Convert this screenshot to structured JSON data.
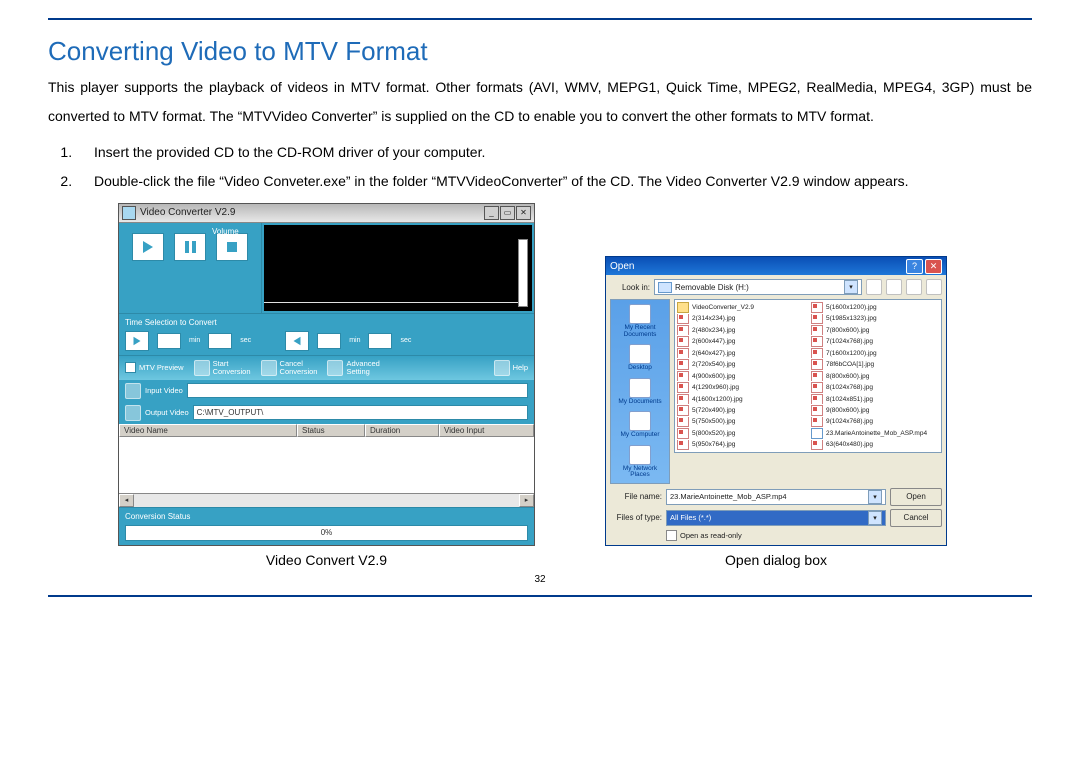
{
  "heading": "Converting Video to MTV Format",
  "intro": "This player supports the playback of videos in MTV format. Other formats (AVI, WMV, MEPG1, Quick Time, MPEG2, RealMedia, MPEG4, 3GP) must be converted to MTV format. The “MTVVideo Converter” is supplied on the CD to enable you to convert the other formats to MTV format.",
  "steps": {
    "s1": "Insert the provided CD to the CD-ROM driver of your computer.",
    "s2_a": "Double-click the file “Video Conveter.exe” in the folder “MTVVideoConverter” of the CD. The ",
    "s2_b": "Video Converter V2.9",
    "s2_c": " window appears."
  },
  "fig1_caption": "Video Convert V2.9",
  "fig2_caption_a": "Open",
  "fig2_caption_b": " dialog box",
  "page_number": "32",
  "vc": {
    "title": "Video Converter V2.9",
    "volume_lbl": "Volume",
    "time_sel": "Time Selection to Convert",
    "min": "min",
    "sec": "sec",
    "mtv_preview": "MTV Preview",
    "start": "Start",
    "start2": "Conversion",
    "cancel": "Cancel",
    "cancel2": "Conversion",
    "adv": "Advanced",
    "adv2": "Setting",
    "help": "Help",
    "input_lbl": "Input Video",
    "output_lbl": "Output Video",
    "output_path": "C:\\MTV_OUTPUT\\",
    "col_name": "Video Name",
    "col_status": "Status",
    "col_duration": "Duration",
    "col_input": "Video Input",
    "conv_status": "Conversion Status",
    "progress": "0%"
  },
  "od": {
    "title": "Open",
    "lookin_lbl": "Look in:",
    "lookin_val": "Removable Disk (H:)",
    "places": {
      "recent": "My Recent\nDocuments",
      "desktop": "Desktop",
      "mydocs": "My Documents",
      "mycomp": "My Computer",
      "mynet": "My Network\nPlaces"
    },
    "files_left": [
      {
        "t": "folder",
        "n": "VideoConverter_V2.9"
      },
      {
        "t": "jpg",
        "n": "2(314x234).jpg"
      },
      {
        "t": "jpg",
        "n": "2(480x234).jpg"
      },
      {
        "t": "jpg",
        "n": "2(600x447).jpg"
      },
      {
        "t": "jpg",
        "n": "2(640x427).jpg"
      },
      {
        "t": "jpg",
        "n": "2(720x540).jpg"
      },
      {
        "t": "jpg",
        "n": "4(900x600).jpg"
      },
      {
        "t": "jpg",
        "n": "4(1290x960).jpg"
      },
      {
        "t": "jpg",
        "n": "4(1600x1200).jpg"
      },
      {
        "t": "jpg",
        "n": "5(720x490).jpg"
      },
      {
        "t": "jpg",
        "n": "5(750x500).jpg"
      },
      {
        "t": "jpg",
        "n": "5(800x520).jpg"
      },
      {
        "t": "jpg",
        "n": "5(950x764).jpg"
      }
    ],
    "files_right": [
      {
        "t": "jpg",
        "n": "5(1600x1200).jpg"
      },
      {
        "t": "jpg",
        "n": "5(1985x1323).jpg"
      },
      {
        "t": "jpg",
        "n": "7(800x600).jpg"
      },
      {
        "t": "jpg",
        "n": "7(1024x768).jpg"
      },
      {
        "t": "jpg",
        "n": "7(1600x1200).jpg"
      },
      {
        "t": "jpg",
        "n": "78f6bCOA[1].jpg"
      },
      {
        "t": "jpg",
        "n": "8(800x600).jpg"
      },
      {
        "t": "jpg",
        "n": "8(1024x768).jpg"
      },
      {
        "t": "jpg",
        "n": "8(1024x851).jpg"
      },
      {
        "t": "jpg",
        "n": "9(800x600).jpg"
      },
      {
        "t": "jpg",
        "n": "9(1024x768).jpg"
      },
      {
        "t": "mp4",
        "n": "23.MarieAntoinette_Mob_ASP.mp4"
      },
      {
        "t": "jpg",
        "n": "63(640x480).jpg"
      }
    ],
    "filename_lbl": "File name:",
    "filename_val": "23.MarieAntoinette_Mob_ASP.mp4",
    "filetype_lbl": "Files of type:",
    "filetype_val": "All Files (*.*)",
    "open_btn": "Open",
    "cancel_btn": "Cancel",
    "readonly": "Open as read-only"
  }
}
